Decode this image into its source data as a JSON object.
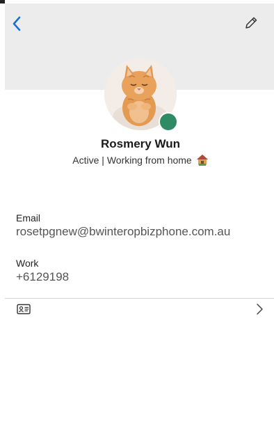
{
  "header": {
    "back_icon": "chevron-left-icon",
    "edit_icon": "pencil-icon",
    "accent_color": "#1a6fd6"
  },
  "profile": {
    "name": "Rosmery Wun",
    "status": "Active | Working from home",
    "status_icon": "house-icon",
    "presence_color": "#2e8b63",
    "avatar": "cat-photo"
  },
  "fields": {
    "email": {
      "label": "Email",
      "value": "rosetpgnew@bwinteropbizphone.com.au"
    },
    "work": {
      "label": "Work",
      "value": "+6129198"
    }
  },
  "contact_card": {
    "icon": "contact-card-icon",
    "chevron": "chevron-right-icon"
  }
}
